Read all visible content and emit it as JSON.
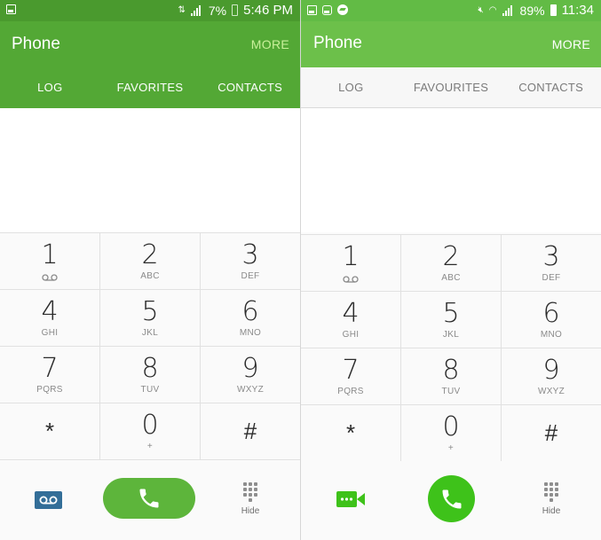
{
  "left": {
    "status": {
      "time": "5:46 PM",
      "battery": "7%"
    },
    "app": {
      "title": "Phone",
      "more": "MORE"
    },
    "tabs": [
      "LOG",
      "FAVORITES",
      "CONTACTS"
    ],
    "keys": [
      {
        "digit": "1",
        "letters": ""
      },
      {
        "digit": "2",
        "letters": "ABC"
      },
      {
        "digit": "3",
        "letters": "DEF"
      },
      {
        "digit": "4",
        "letters": "GHI"
      },
      {
        "digit": "5",
        "letters": "JKL"
      },
      {
        "digit": "6",
        "letters": "MNO"
      },
      {
        "digit": "7",
        "letters": "PQRS"
      },
      {
        "digit": "8",
        "letters": "TUV"
      },
      {
        "digit": "9",
        "letters": "WXYZ"
      },
      {
        "digit": "*",
        "letters": ""
      },
      {
        "digit": "0",
        "letters": "+"
      },
      {
        "digit": "#",
        "letters": ""
      }
    ],
    "bottom": {
      "hide": "Hide"
    },
    "icons": {
      "left_action": "voicemail-icon",
      "call": "phone-icon",
      "hide": "dialpad-icon"
    }
  },
  "right": {
    "status": {
      "time": "11:34",
      "battery": "89%"
    },
    "app": {
      "title": "Phone",
      "more": "MORE"
    },
    "tabs": [
      "LOG",
      "FAVOURITES",
      "CONTACTS"
    ],
    "keys": [
      {
        "digit": "1",
        "letters": ""
      },
      {
        "digit": "2",
        "letters": "ABC"
      },
      {
        "digit": "3",
        "letters": "DEF"
      },
      {
        "digit": "4",
        "letters": "GHI"
      },
      {
        "digit": "5",
        "letters": "JKL"
      },
      {
        "digit": "6",
        "letters": "MNO"
      },
      {
        "digit": "7",
        "letters": "PQRS"
      },
      {
        "digit": "8",
        "letters": "TUV"
      },
      {
        "digit": "9",
        "letters": "WXYZ"
      },
      {
        "digit": "*",
        "letters": ""
      },
      {
        "digit": "0",
        "letters": "+"
      },
      {
        "digit": "#",
        "letters": ""
      }
    ],
    "bottom": {
      "hide": "Hide"
    },
    "icons": {
      "left_action": "video-call-icon",
      "call": "phone-icon",
      "hide": "dialpad-icon"
    }
  },
  "colors": {
    "left_header": "#53a835",
    "right_header": "#6cc04a",
    "left_call": "#5db53b",
    "right_call": "#3ec21a",
    "voicemail": "#336e98"
  }
}
